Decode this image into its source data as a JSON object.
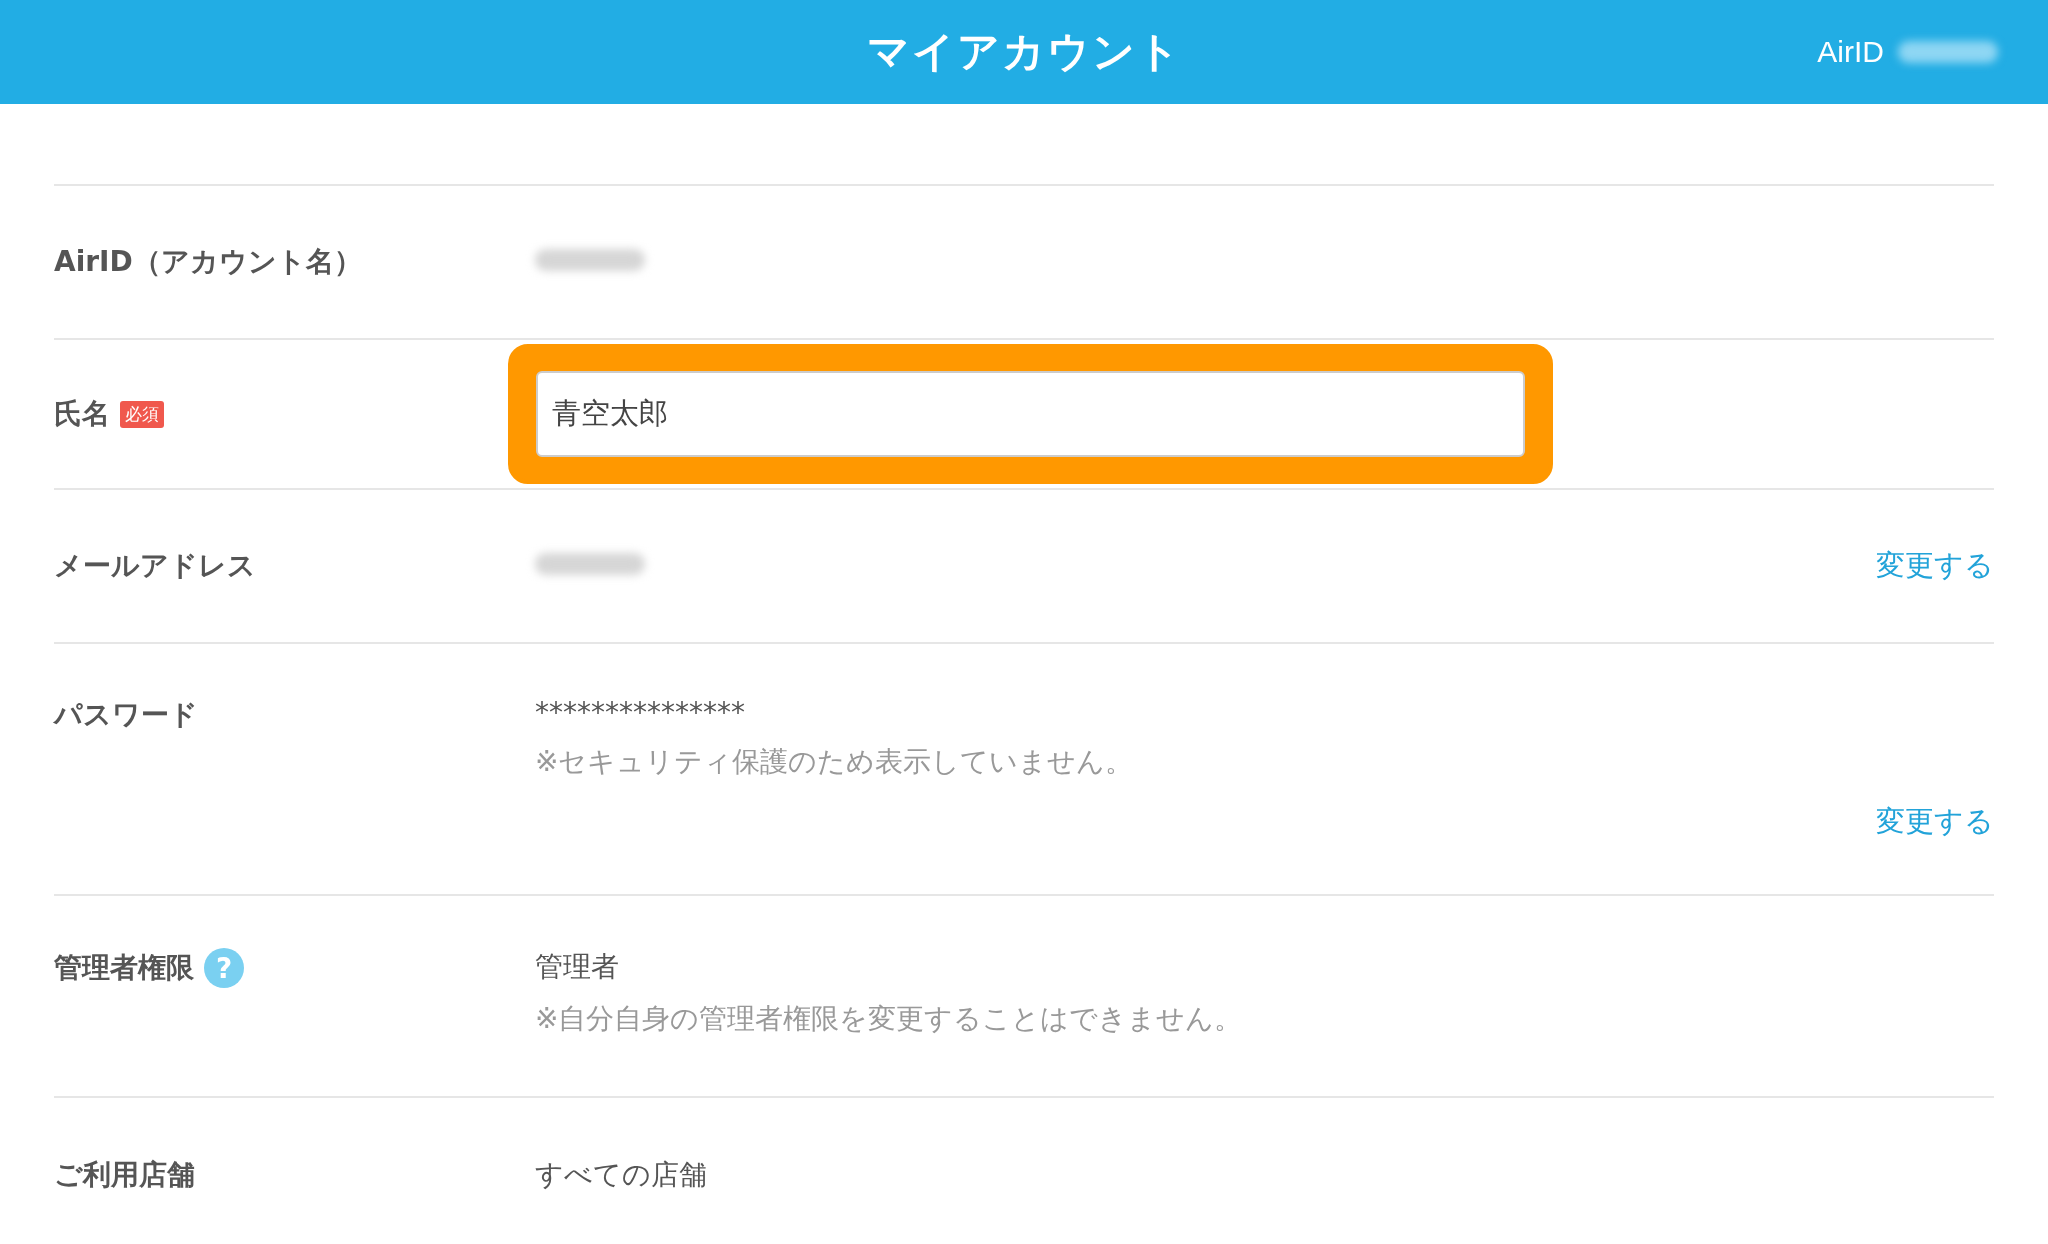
{
  "header": {
    "title": "マイアカウント",
    "account_label": "AirID"
  },
  "rows": [
    {
      "kind": "redacted",
      "label": "AirID（アカウント名）"
    },
    {
      "kind": "input",
      "label": "氏名",
      "badge": "必須",
      "value": "青空太郎",
      "highlighted": true
    },
    {
      "kind": "redacted",
      "label": "メールアドレス",
      "action": "変更する"
    },
    {
      "kind": "notes",
      "label": "パスワード",
      "value": "***************",
      "note": "※セキュリティ保護のため表示していません。",
      "action": "変更する"
    },
    {
      "kind": "notes",
      "label": "管理者権限",
      "help": "?",
      "value": "管理者",
      "note": "※自分自身の管理者権限を変更することはできません。"
    },
    {
      "kind": "plain",
      "label": "ご利用店舗",
      "value": "すべての店舗"
    }
  ]
}
